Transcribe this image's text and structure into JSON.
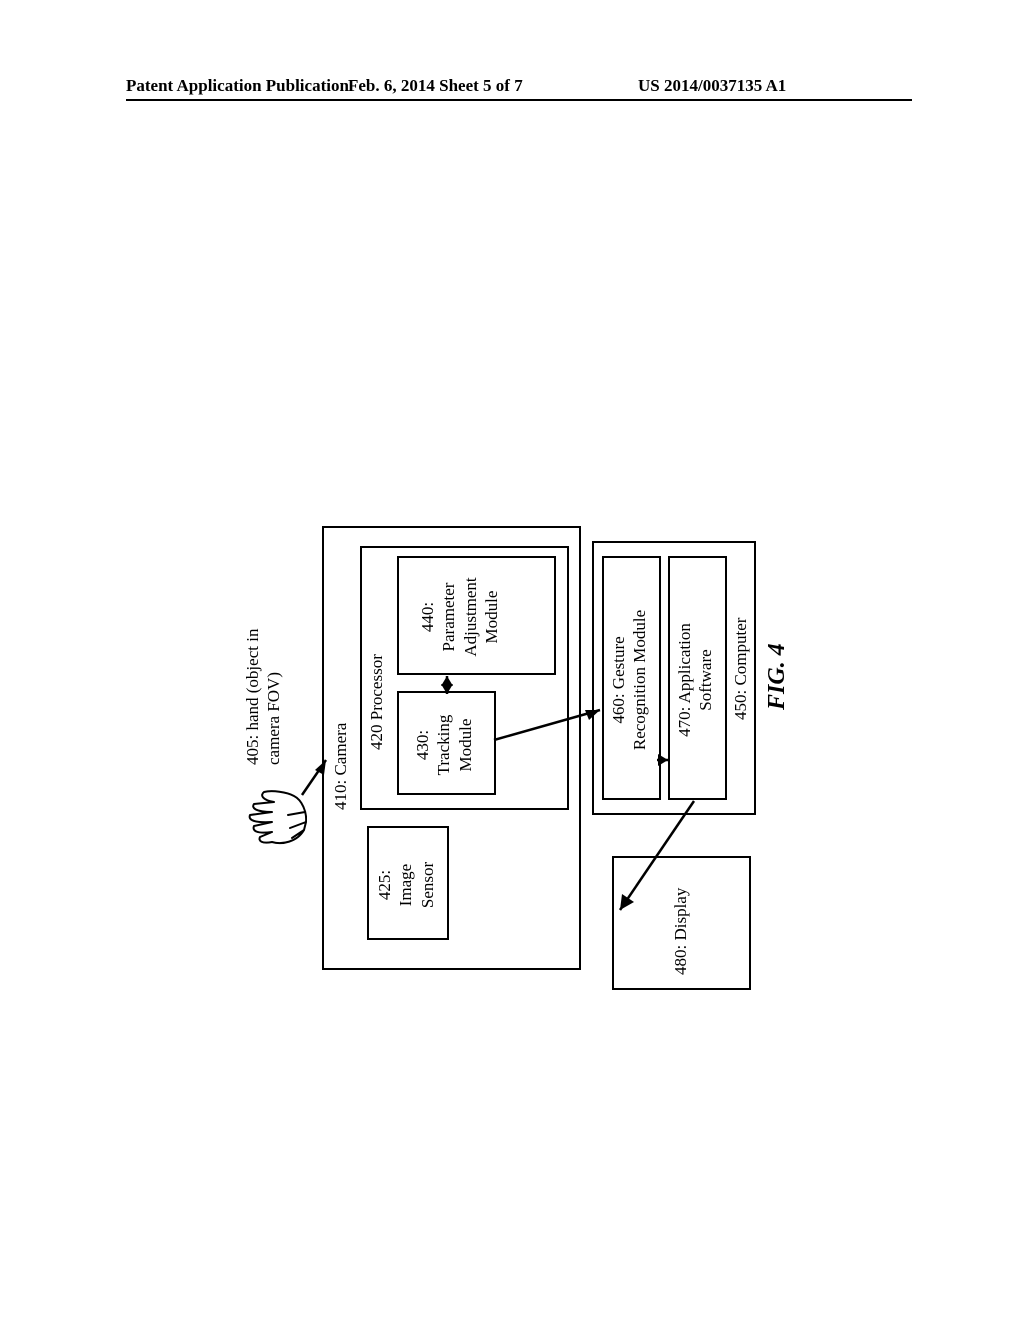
{
  "header": {
    "left": "Patent Application Publication",
    "center": "Feb. 6, 2014  Sheet 5 of 7",
    "right": "US 2014/0037135 A1"
  },
  "diagram": {
    "hand_label": "405: hand (object in\ncamera FOV)",
    "camera": "410: Camera",
    "image_sensor": "425:\nImage\nSensor",
    "processor": "420 Processor",
    "tracking": "430:\nTracking\nModule",
    "parameter": "440:\nParameter\nAdjustment\nModule",
    "computer": "450: Computer",
    "gesture": "460: Gesture\nRecognition Module",
    "application": "470: Application\nSoftware",
    "display": "480: Display",
    "figure": "FIG. 4"
  }
}
